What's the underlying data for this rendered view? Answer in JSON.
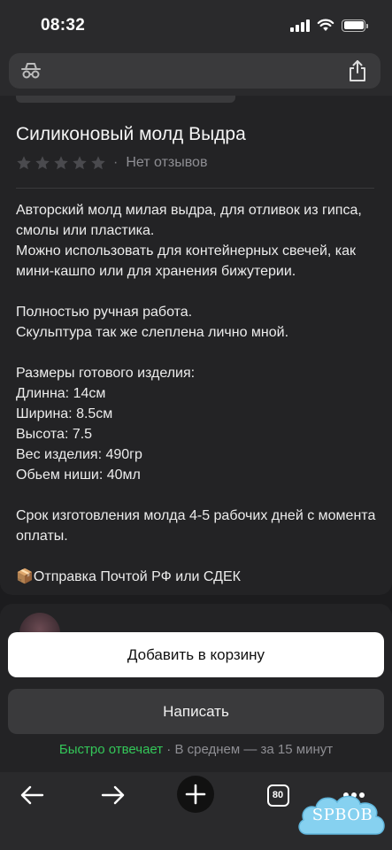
{
  "status_bar": {
    "time": "08:32"
  },
  "product": {
    "title": "Силиконовый молд Выдра",
    "rating_stars": 0,
    "reviews_label": "Нет отзывов",
    "description": "Авторский молд милая выдра, для отливок из гипса, смолы или пластика.\nМожно использовать для контейнерных свечей, как мини-кашпо или для хранения бижутерии.\n\nПолностью ручная работа.\nСкульптура так же слеплена лично мной.\n\nРазмеры готового изделия:\nДлинна: 14см\nШирина: 8.5см\nВысота: 7.5\nВес изделия: 490гр\nОбьем ниши: 40мл\n\nСрок изготовления молда 4-5 рабочих дней с момента оплаты.\n\n📦Отправка Почтой РФ или СДЕК"
  },
  "actions": {
    "add_to_cart_label": "Добавить в корзину",
    "message_label": "Написать"
  },
  "reply_info": {
    "fast_label": "Быстро отвечает",
    "separator": " · ",
    "average_label": "В среднем — за 15 минут"
  },
  "toolbar": {
    "tab_count": "80",
    "icons": [
      "back-arrow-icon",
      "forward-arrow-icon",
      "plus-icon",
      "tabs-icon",
      "more-icon"
    ]
  },
  "watermark": {
    "text": "SPBOB"
  },
  "colors": {
    "background": "#1c1c1e",
    "card": "#232325",
    "accent_green": "#34c759",
    "primary_button": "#ffffff",
    "secondary_button": "#3a3a3c"
  }
}
